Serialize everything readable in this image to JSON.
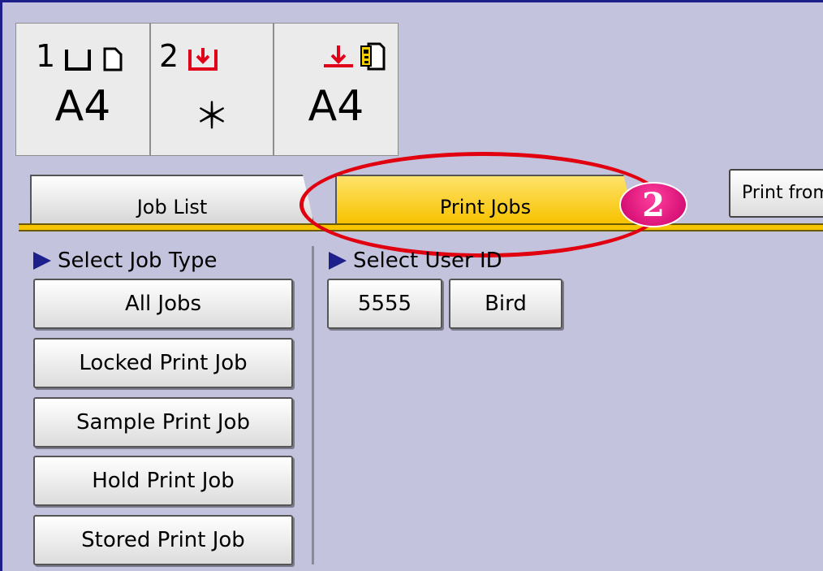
{
  "trays": [
    {
      "number": "1",
      "paper": "A4",
      "icons": [
        "tray-icon",
        "paper-sheet-icon"
      ]
    },
    {
      "number": "2",
      "paper": "＊",
      "icons": [
        "tray-arrow-icon"
      ]
    },
    {
      "number": "",
      "paper": "A4",
      "icons": [
        "bypass-arrow-icon",
        "paper-key-icon"
      ]
    }
  ],
  "tabs": {
    "job_list": "Job List",
    "print_jobs": "Print Jobs",
    "print_from": "Print from"
  },
  "annotation": {
    "badge": "2"
  },
  "job_type": {
    "label": "Select Job Type",
    "buttons": [
      "All Jobs",
      "Locked Print Job",
      "Sample Print Job",
      "Hold Print Job",
      "Stored Print Job"
    ]
  },
  "user_id": {
    "label": "Select User ID",
    "buttons": [
      "5555",
      "Bird"
    ]
  },
  "colors": {
    "background": "#c4c3dd",
    "tab_active": "#f6c400",
    "highlight": "#e0000f",
    "badge": "#e0107a"
  }
}
